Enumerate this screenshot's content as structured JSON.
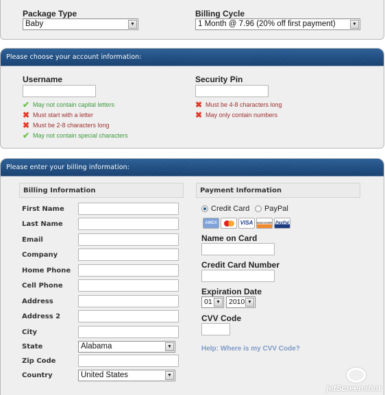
{
  "package": {
    "package_type_label": "Package Type",
    "package_type_value": "Baby",
    "billing_cycle_label": "Billing Cycle",
    "billing_cycle_value": "1 Month @ 7.96 (20% off first payment)"
  },
  "account": {
    "header": "Please choose your account information:",
    "username_label": "Username",
    "username_value": "",
    "username_rules": [
      {
        "text": "May not contain capital letters",
        "status": "ok"
      },
      {
        "text": "Must start with a letter",
        "status": "fail"
      },
      {
        "text": "Must be 2-8 characters long",
        "status": "fail"
      },
      {
        "text": "May not contain special characters",
        "status": "ok"
      }
    ],
    "pin_label": "Security Pin",
    "pin_value": "",
    "pin_rules": [
      {
        "text": "Must be 4-8 characters long",
        "status": "fail"
      },
      {
        "text": "May only contain numbers",
        "status": "fail"
      }
    ],
    "status_icons": {
      "ok": "✔",
      "fail": "✖"
    }
  },
  "billing": {
    "header": "Please enter your billing information:",
    "section_title": "Billing Information",
    "fields": [
      {
        "label": "First Name",
        "value": ""
      },
      {
        "label": "Last Name",
        "value": ""
      },
      {
        "label": "Email",
        "value": ""
      },
      {
        "label": "Company",
        "value": ""
      },
      {
        "label": "Home Phone",
        "value": ""
      },
      {
        "label": "Cell Phone",
        "value": ""
      },
      {
        "label": "Address",
        "value": ""
      },
      {
        "label": "Address 2",
        "value": ""
      },
      {
        "label": "City",
        "value": ""
      },
      {
        "label": "State",
        "value": "Alabama"
      },
      {
        "label": "Zip Code",
        "value": ""
      },
      {
        "label": "Country",
        "value": "United States"
      }
    ]
  },
  "payment": {
    "section_title": "Payment Information",
    "method_credit_card": "Credit Card",
    "method_paypal": "PayPal",
    "selected_method": "Credit Card",
    "cards": [
      "AMEX",
      "MasterCard",
      "VISA",
      "DISCOVER",
      "PayPal"
    ],
    "name_on_card_label": "Name on Card",
    "card_number_label": "Credit Card Number",
    "expiration_label": "Expiration Date",
    "exp_month": "01",
    "exp_year": "2010",
    "cvv_label": "CVV Code",
    "help_link": "Help: Where is my CVV Code?"
  },
  "watermark": "jetScreenshot",
  "dropdown_arrow": "▼"
}
